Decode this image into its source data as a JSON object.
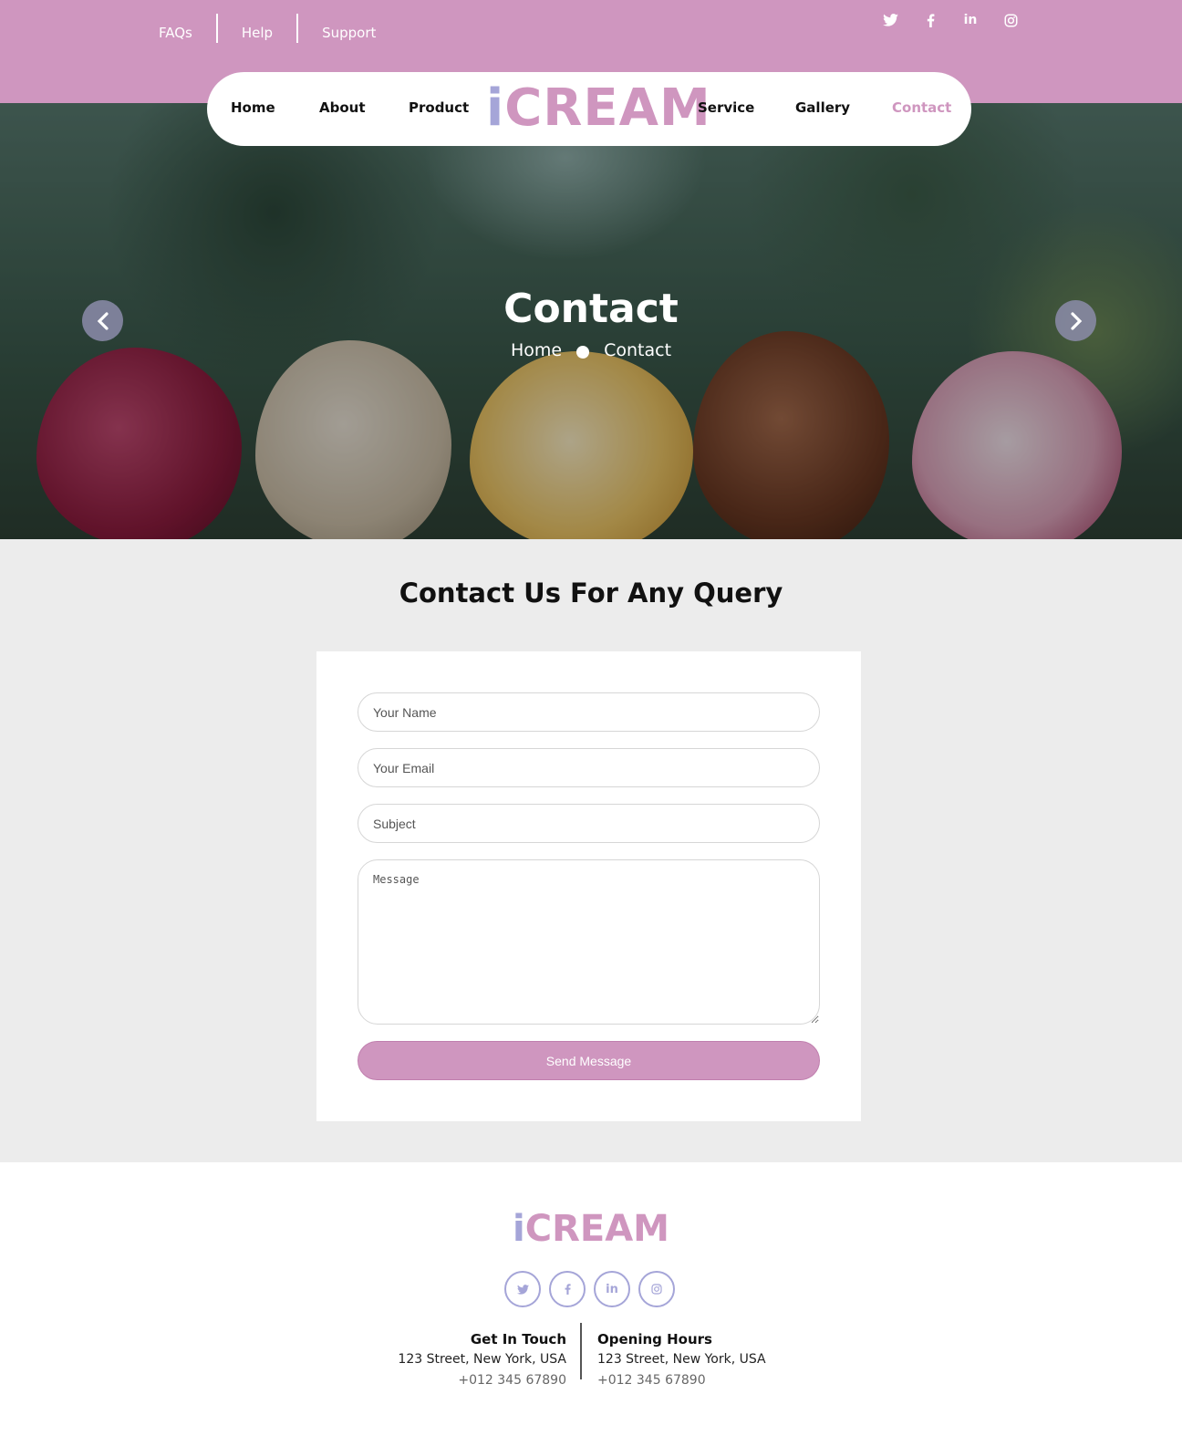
{
  "topbar": {
    "links": [
      "FAQs",
      "Help",
      "Support"
    ],
    "social_icons": [
      "twitter-icon",
      "facebook-icon",
      "linkedin-icon",
      "instagram-icon"
    ]
  },
  "nav": {
    "left": [
      "Home",
      "About",
      "Product"
    ],
    "logo_i": "i",
    "logo_rest": "CREAM",
    "right": [
      "Service",
      "Gallery",
      "Contact"
    ],
    "active": "Contact"
  },
  "hero": {
    "title": "Contact",
    "breadcrumb": [
      "Home",
      "Contact"
    ]
  },
  "contact": {
    "heading": "Contact Us For Any Query",
    "form": {
      "name_placeholder": "Your Name",
      "email_placeholder": "Your Email",
      "subject_placeholder": "Subject",
      "message_placeholder": "Message",
      "send_label": "Send Message"
    }
  },
  "footer": {
    "logo_i": "i",
    "logo_rest": "CREAM",
    "get_in_touch": {
      "title": "Get In Touch",
      "address": "123 Street, New York, USA",
      "phone": "+012 345 67890"
    },
    "opening_hours": {
      "title": "Opening Hours",
      "address": "123 Street, New York, USA",
      "phone": "+012 345 67890"
    }
  },
  "colors": {
    "brand_pink": "#cf96bf",
    "brand_lavender": "#a5a5d8",
    "section_gray": "#ececec"
  }
}
